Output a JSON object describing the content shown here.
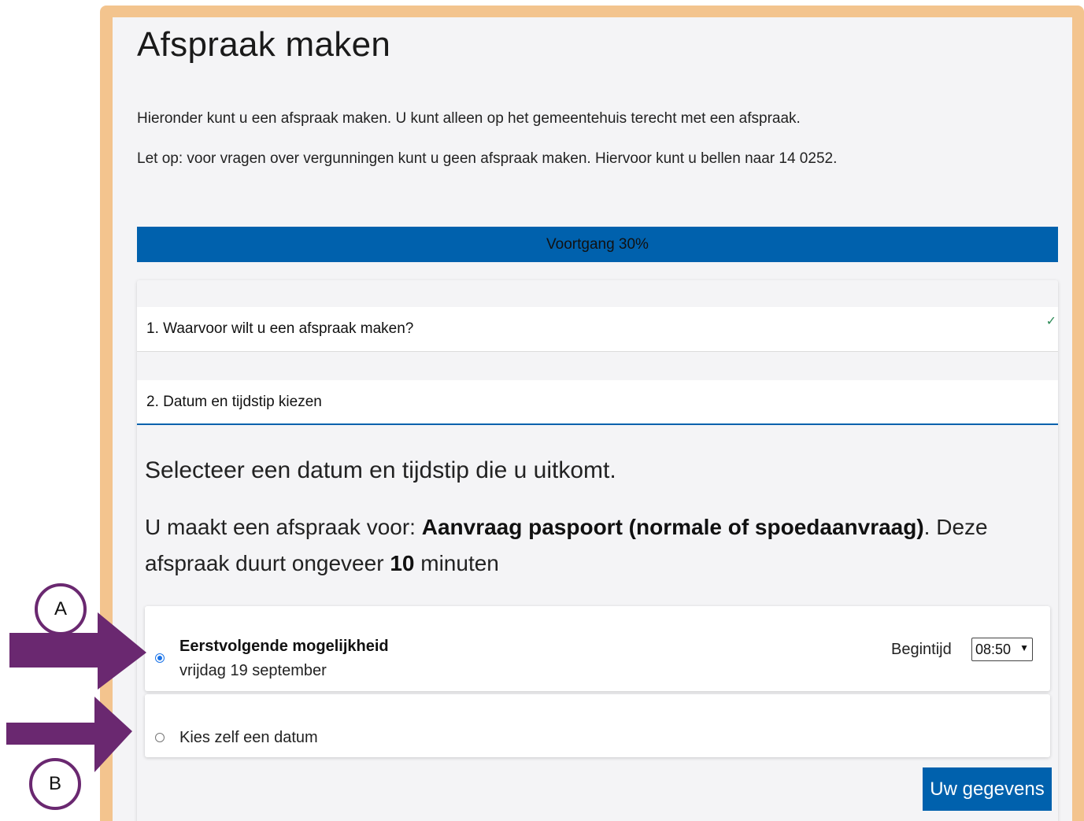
{
  "page": {
    "title": "Afspraak maken",
    "intro_1": "Hieronder kunt u een afspraak maken. U kunt alleen op het gemeentehuis terecht met een afspraak.",
    "intro_2": "Let op: voor vragen over vergunningen kunt u geen afspraak maken. Hiervoor kunt u bellen naar 14 0252."
  },
  "progress": {
    "label": "Voortgang 30%",
    "value": 30
  },
  "steps": [
    {
      "label": "1. Waarvoor wilt u een afspraak maken?",
      "completed": true,
      "check_icon": "check-icon"
    },
    {
      "label": "2. Datum en tijdstip kiezen",
      "active": true
    }
  ],
  "step2": {
    "heading": "Selecteer een datum en tijdstip die u uitkomt.",
    "info_prefix": "U maakt een afspraak voor: ",
    "info_service": "Aanvraag paspoort (normale of spoedaanvraag)",
    "info_middle": ". Deze afspraak duurt ongeveer ",
    "info_duration": "10",
    "info_suffix": " minuten"
  },
  "options": {
    "first": {
      "title": "Eerstvolgende mogelijkheid",
      "date": "vrijdag 19 september",
      "selected": true,
      "start_label": "Begintijd",
      "start_value": "08:50"
    },
    "choose": {
      "label": "Kies zelf een datum",
      "selected": false
    }
  },
  "next_button": "Uw gegevens",
  "annotations": {
    "a_label": "A",
    "b_label": "B",
    "arrow_color": "#6a2870"
  },
  "colors": {
    "primary": "#0061ad",
    "frame": "#f3c48e",
    "annotation": "#6a2870"
  }
}
